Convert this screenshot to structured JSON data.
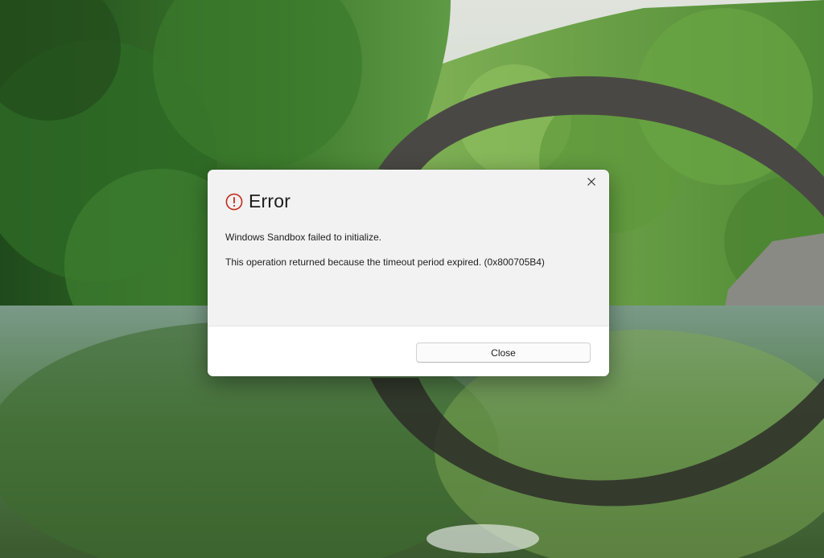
{
  "dialog": {
    "title": "Error",
    "message_line1": "Windows Sandbox failed to initialize.",
    "message_line2": "This operation returned because the timeout period expired. (0x800705B4)",
    "close_button_label": "Close",
    "icon": "error-circle-icon",
    "title_bar_close_icon": "close-icon"
  },
  "colors": {
    "error_icon": "#c42b1c",
    "dialog_body": "#f2f2f2",
    "dialog_footer": "#ffffff"
  }
}
